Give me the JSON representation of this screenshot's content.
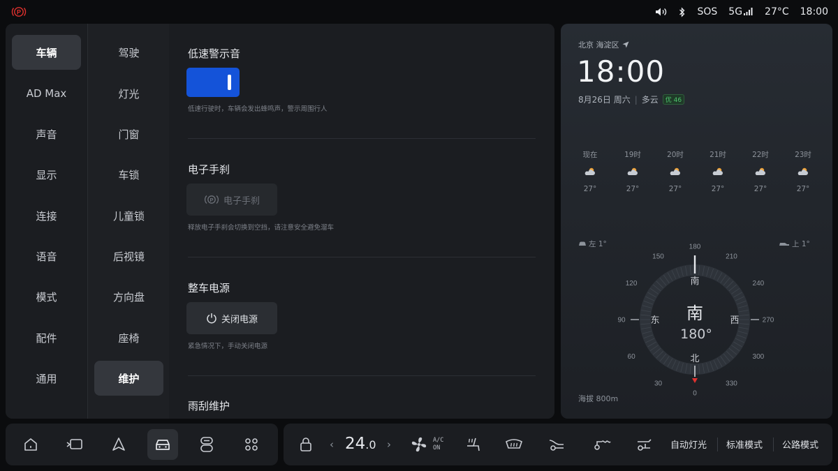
{
  "status": {
    "sos": "SOS",
    "network": "5G",
    "temperature": "27°C",
    "time": "18:00"
  },
  "nav_primary": [
    {
      "label": "车辆",
      "active": true
    },
    {
      "label": "AD Max",
      "active": false
    },
    {
      "label": "声音",
      "active": false
    },
    {
      "label": "显示",
      "active": false
    },
    {
      "label": "连接",
      "active": false
    },
    {
      "label": "语音",
      "active": false
    },
    {
      "label": "模式",
      "active": false
    },
    {
      "label": "配件",
      "active": false
    },
    {
      "label": "通用",
      "active": false
    }
  ],
  "nav_secondary": [
    {
      "label": "驾驶",
      "active": false
    },
    {
      "label": "灯光",
      "active": false
    },
    {
      "label": "门窗",
      "active": false
    },
    {
      "label": "车锁",
      "active": false
    },
    {
      "label": "儿童锁",
      "active": false
    },
    {
      "label": "后视镜",
      "active": false
    },
    {
      "label": "方向盘",
      "active": false
    },
    {
      "label": "座椅",
      "active": false
    },
    {
      "label": "维护",
      "active": true
    }
  ],
  "content": {
    "low_speed_warning": {
      "title": "低速警示音",
      "enabled": true,
      "desc": "低速行驶时，车辆会发出蜂鸣声，警示周围行人"
    },
    "epb": {
      "title": "电子手刹",
      "button": "电子手刹",
      "desc": "释放电子手刹会切换到空挡，请注意安全避免溜车"
    },
    "power": {
      "title": "整车电源",
      "button": "关闭电源",
      "desc": "紧急情况下，手动关闭电源"
    },
    "wiper": {
      "title": "雨刮维护"
    }
  },
  "weather": {
    "location": "北京 海淀区",
    "time": "18:00",
    "date": "8月26日 周六",
    "condition": "多云",
    "aqi": "优 46",
    "hourly": [
      {
        "hour": "现在",
        "temp": "27°"
      },
      {
        "hour": "19时",
        "temp": "27°"
      },
      {
        "hour": "20时",
        "temp": "27°"
      },
      {
        "hour": "21时",
        "temp": "27°"
      },
      {
        "hour": "22时",
        "temp": "27°"
      },
      {
        "hour": "23时",
        "temp": "27°"
      }
    ],
    "roll": "左 1°",
    "pitch": "上 1°",
    "compass": {
      "heading_label": "南",
      "heading_degrees": "180°",
      "dirs": {
        "south": "南",
        "north": "北",
        "east": "东",
        "west": "西"
      },
      "ticks": [
        "180",
        "210",
        "240",
        "270",
        "300",
        "330",
        "0",
        "30",
        "60",
        "90",
        "120",
        "150"
      ]
    },
    "altitude": "海拔 800m"
  },
  "dock_left": {
    "icons": [
      "home-icon",
      "screen-switch-icon",
      "navigation-icon",
      "car-icon",
      "toggle-icon",
      "apps-icon"
    ],
    "active_index": 3
  },
  "climate": {
    "temp_int": "24",
    "temp_dec": ".0",
    "ac_line1": "A/C",
    "ac_line2": "ON"
  },
  "quick_modes": [
    "自动灯光",
    "标准模式",
    "公路模式"
  ],
  "colors": {
    "accent": "#1453d9",
    "park_brake": "#e0312e",
    "aqi_green": "#4ec46d",
    "compass_red": "#e0312e"
  }
}
